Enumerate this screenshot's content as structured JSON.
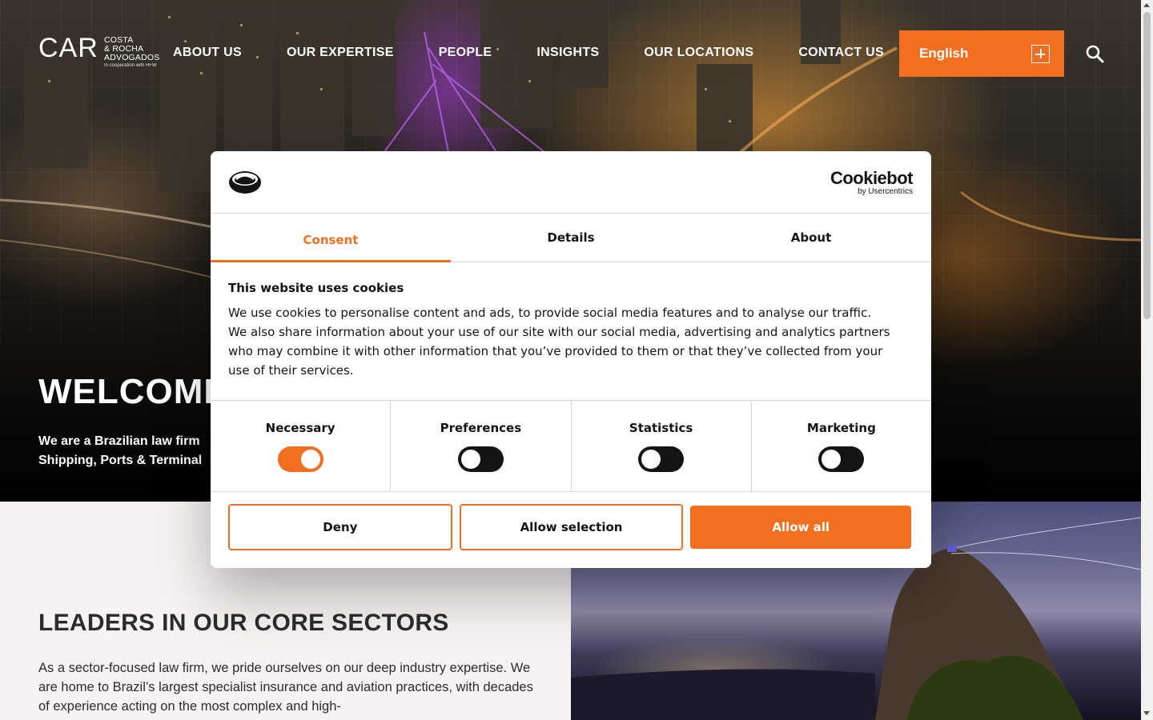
{
  "header": {
    "logo": {
      "mark": "CAR",
      "firm_line1": "COSTA",
      "firm_line2": "& ROCHA",
      "firm_line3": "ADVOGADOS",
      "cooperation": "In cooperation with HFW"
    },
    "nav": [
      "ABOUT US",
      "OUR EXPERTISE",
      "PEOPLE",
      "INSIGHTS",
      "OUR LOCATIONS",
      "CONTACT US"
    ],
    "language": "English",
    "search_icon": "search-icon"
  },
  "hero": {
    "title": "WELCOME",
    "subtitle_line1": "We are a Brazilian law firm",
    "subtitle_line2": "Shipping, Ports & Terminal"
  },
  "section": {
    "title": "LEADERS IN OUR CORE SECTORS",
    "body": "As a sector-focused law firm, we pride ourselves on our deep industry expertise. We are home to Brazil’s largest specialist insurance and aviation practices, with decades of experience acting on the most complex and high-"
  },
  "cookie_dialog": {
    "brand": "Cookiebot",
    "brand_sub": "by Usercentrics",
    "tabs": [
      "Consent",
      "Details",
      "About"
    ],
    "active_tab": "Consent",
    "heading": "This website uses cookies",
    "text": "We use cookies to personalise content and ads, to provide social media features and to analyse our traffic. We also share information about your use of our site with our social media, advertising and analytics partners who may combine it with other information that you’ve provided to them or that they’ve collected from your use of their services.",
    "toggles": [
      {
        "label": "Necessary",
        "on": true
      },
      {
        "label": "Preferences",
        "on": false
      },
      {
        "label": "Statistics",
        "on": false
      },
      {
        "label": "Marketing",
        "on": false
      }
    ],
    "buttons": {
      "deny": "Deny",
      "allow_selection": "Allow selection",
      "allow_all": "Allow all"
    }
  },
  "colors": {
    "accent": "#f26f21",
    "dark": "#141414",
    "section_bg": "#f7f3f2"
  }
}
